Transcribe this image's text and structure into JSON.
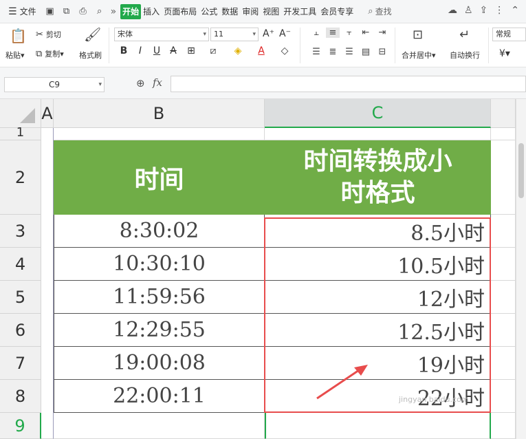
{
  "menu": {
    "file_label": "文件",
    "tabs": [
      "开始",
      "插入",
      "页面布局",
      "公式",
      "数据",
      "审阅",
      "视图",
      "开发工具",
      "会员专享"
    ],
    "search_label": "查找"
  },
  "ribbon": {
    "paste": "粘贴",
    "cut": "剪切",
    "copy": "复制",
    "format_painter": "格式刷",
    "font_name": "宋体",
    "font_size": "11",
    "merge_center": "合并居中",
    "wrap_text": "自动换行",
    "number_format": "常规",
    "currency": "¥"
  },
  "formula_bar": {
    "name_box": "C9",
    "fx": "fx",
    "formula": ""
  },
  "grid": {
    "columns": [
      "A",
      "B",
      "C"
    ],
    "selected_column": "C",
    "row_numbers": [
      "1",
      "2",
      "3",
      "4",
      "5",
      "6",
      "7",
      "8",
      "9"
    ],
    "selected_row": "9",
    "header_b": "时间",
    "header_c": "时间转换成小时格式",
    "rows": [
      {
        "time": "8:30:02",
        "hours": "8.5小时"
      },
      {
        "time": "10:30:10",
        "hours": "10.5小时"
      },
      {
        "time": "11:59:56",
        "hours": "12小时"
      },
      {
        "time": "12:29:55",
        "hours": "12.5小时"
      },
      {
        "time": "19:00:08",
        "hours": "19小时"
      },
      {
        "time": "22:00:11",
        "hours": "22小时"
      }
    ]
  },
  "watermark": "jingyan.baidu.com",
  "colors": {
    "accent": "#22a94b",
    "header_fill": "#70ad47",
    "highlight": "#e84c4c"
  }
}
